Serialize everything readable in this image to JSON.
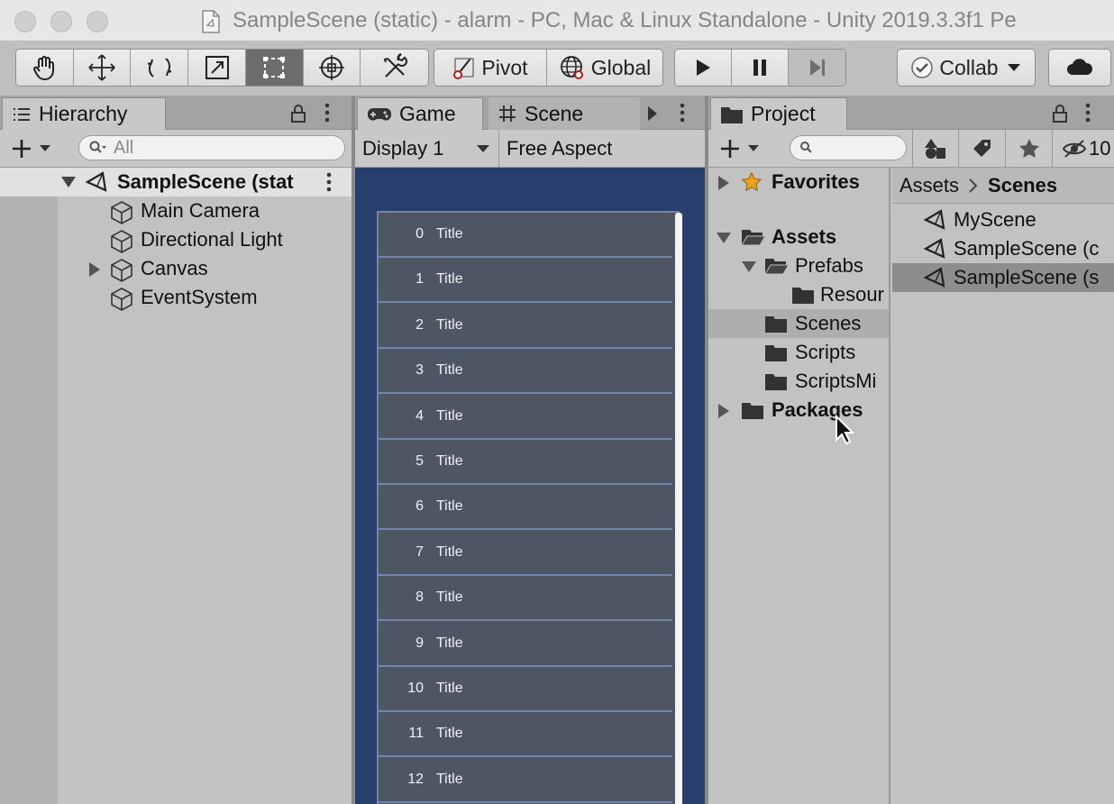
{
  "window": {
    "title": "SampleScene (static) - alarm - PC, Mac & Linux Standalone - Unity 2019.3.3f1 Pe"
  },
  "toolbar": {
    "tools": [
      "hand-tool",
      "move-tool",
      "rotate-tool",
      "scale-tool",
      "rect-tool",
      "transform-tool",
      "custom-tool"
    ],
    "active_tool": "rect-tool",
    "pivot_label": "Pivot",
    "global_label": "Global",
    "collab_label": "Collab"
  },
  "hierarchy": {
    "tab_label": "Hierarchy",
    "search_placeholder": "All",
    "scene_name": "SampleScene (stat",
    "items": [
      "Main Camera",
      "Directional Light",
      "Canvas",
      "EventSystem"
    ]
  },
  "game": {
    "tab_game": "Game",
    "tab_scene": "Scene",
    "display": "Display 1",
    "aspect": "Free Aspect",
    "rows": [
      {
        "num": "0",
        "title": "Title"
      },
      {
        "num": "1",
        "title": "Title"
      },
      {
        "num": "2",
        "title": "Title"
      },
      {
        "num": "3",
        "title": "Title"
      },
      {
        "num": "4",
        "title": "Title"
      },
      {
        "num": "5",
        "title": "Title"
      },
      {
        "num": "6",
        "title": "Title"
      },
      {
        "num": "7",
        "title": "Title"
      },
      {
        "num": "8",
        "title": "Title"
      },
      {
        "num": "9",
        "title": "Title"
      },
      {
        "num": "10",
        "title": "Title"
      },
      {
        "num": "11",
        "title": "Title"
      },
      {
        "num": "12",
        "title": "Title"
      }
    ]
  },
  "project": {
    "tab_label": "Project",
    "hidden_count": "10",
    "favorites": "Favorites",
    "assets": "Assets",
    "prefabs": "Prefabs",
    "resources": "Resour",
    "scenes": "Scenes",
    "scripts": "Scripts",
    "scripts_mi": "ScriptsMi",
    "packages": "Packages",
    "breadcrumb_root": "Assets",
    "breadcrumb_current": "Scenes",
    "files": [
      "MyScene",
      "SampleScene (c",
      "SampleScene (s"
    ]
  },
  "colors": {
    "game_background": "#283f6e",
    "row_background": "#4f5663",
    "row_border": "#7384ad",
    "favorites_star": "#e8a21c",
    "active_tool": "#6d6d6d"
  }
}
